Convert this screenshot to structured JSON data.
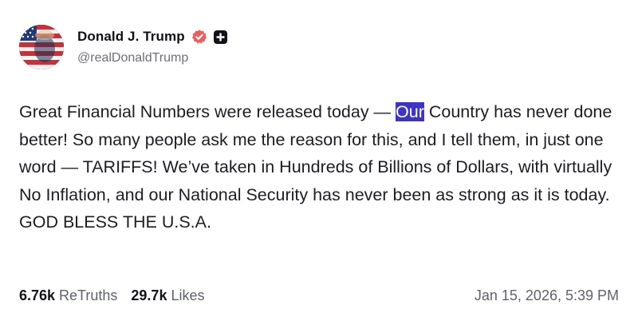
{
  "author": {
    "display_name": "Donald J. Trump",
    "handle": "@realDonaldTrump",
    "avatar_icon": "profile-avatar-flag",
    "verified_icon": "verified-badge-icon",
    "badge_icon": "truth-social-plus-icon",
    "verified_color": "#f05d5d"
  },
  "post": {
    "text_before": "Great Financial Numbers were released today — ",
    "text_highlight": "Our",
    "text_after": " Country has never done better! So many people ask me the reason for this, and I tell them, in just one word — TARIFFS! We’ve taken in Hundreds of Billions of Dollars, with virtually No Inflation, and our National Security has never been as strong as it is today. GOD BLESS THE U.S.A.",
    "highlight_color": "#3d33c9"
  },
  "footer": {
    "retruths_count": "6.76k",
    "retruths_label": "ReTruths",
    "likes_count": "29.7k",
    "likes_label": "Likes",
    "timestamp": "Jan 15, 2026, 5:39 PM"
  }
}
